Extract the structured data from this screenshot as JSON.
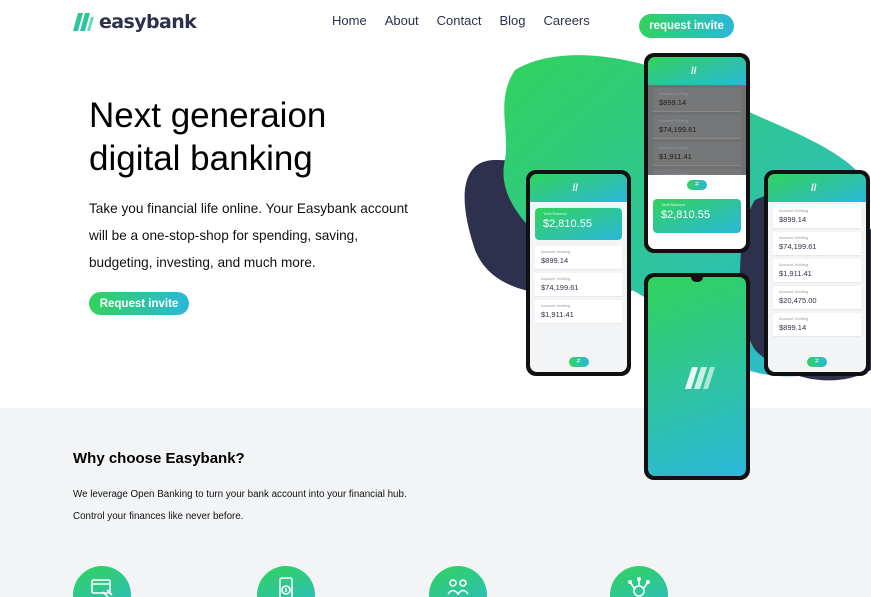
{
  "brand": {
    "name": "easybank"
  },
  "nav": {
    "items": [
      "Home",
      "About",
      "Contact",
      "Blog",
      "Careers"
    ]
  },
  "header": {
    "cta_label": "request invite"
  },
  "hero": {
    "title_line1": "Next generaion",
    "title_line2": "digital banking",
    "description": "Take you financial life online. Your Easybank account will be a one-stop-shop for spending, saving, budgeting, investing, and much more.",
    "cta_label": "Request invite"
  },
  "mockup": {
    "balance_label": "Total Balance",
    "balance": "$2,810.55",
    "account_label": "Account Holding",
    "account_values": [
      "$899.14",
      "$74,199.61",
      "$1,911.41",
      "$20,475.00"
    ]
  },
  "why": {
    "title": "Why choose Easybank?",
    "description_line1": "We leverage Open Banking to turn your bank account into your financial hub.",
    "description_line2": "Control your finances like never before.",
    "icons": [
      "online-banking-icon",
      "budgeting-icon",
      "onboarding-icon",
      "open-api-icon"
    ]
  },
  "colors": {
    "brand_green": "#31d35c",
    "brand_cyan": "#2bb7da",
    "dark_navy": "#2d314d",
    "light_gray": "#f2f4f6"
  }
}
